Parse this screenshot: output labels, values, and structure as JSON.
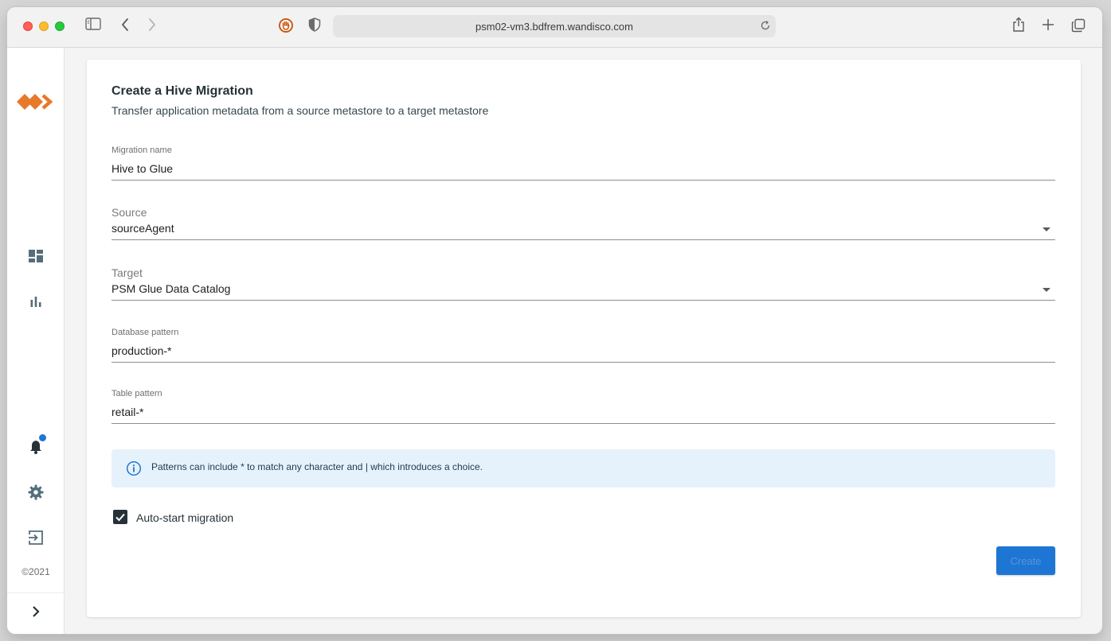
{
  "browser": {
    "url": "psm02-vm3.bdfrem.wandisco.com"
  },
  "sidebar": {
    "copyright": "©2021",
    "icons": [
      "logo-icon",
      "dashboard-icon",
      "bar-chart-icon",
      "notifications-bell-icon",
      "gear-icon",
      "sign-out-icon",
      "chevron-right-icon"
    ]
  },
  "form": {
    "title": "Create a Hive Migration",
    "subtitle": "Transfer application metadata from a source metastore to a target metastore",
    "migration_name": {
      "label": "Migration name",
      "value": "Hive to Glue"
    },
    "source": {
      "label": "Source",
      "value": "sourceAgent"
    },
    "target": {
      "label": "Target",
      "value": "PSM Glue Data Catalog"
    },
    "database_pattern": {
      "label": "Database pattern",
      "value": "production-*"
    },
    "table_pattern": {
      "label": "Table pattern",
      "value": "retail-*"
    },
    "info_text": "Patterns can include * to match any character and | which introduces a choice.",
    "auto_start": {
      "label": "Auto-start migration",
      "checked": true
    },
    "create_label": "Create"
  },
  "colors": {
    "accent": "#1e76d4",
    "brand_orange": "#e8792a",
    "info_bg": "#e6f2fb"
  }
}
